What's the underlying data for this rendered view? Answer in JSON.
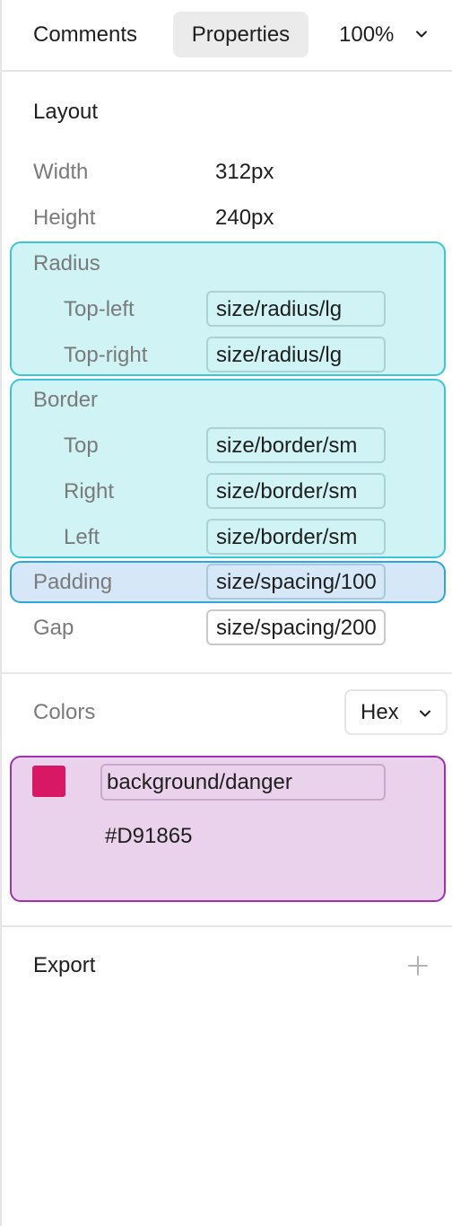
{
  "header": {
    "tabs": [
      {
        "label": "Comments",
        "active": false
      },
      {
        "label": "Properties",
        "active": true
      }
    ],
    "zoom": "100%"
  },
  "layout": {
    "title": "Layout",
    "width_label": "Width",
    "width_value": "312px",
    "height_label": "Height",
    "height_value": "240px",
    "radius": {
      "label": "Radius",
      "top_left_label": "Top-left",
      "top_left_token": "size/radius/lg",
      "top_right_label": "Top-right",
      "top_right_token": "size/radius/lg"
    },
    "border": {
      "label": "Border",
      "top_label": "Top",
      "top_token": "size/border/sm",
      "right_label": "Right",
      "right_token": "size/border/sm",
      "left_label": "Left",
      "left_token": "size/border/sm"
    },
    "padding_label": "Padding",
    "padding_token": "size/spacing/100",
    "gap_label": "Gap",
    "gap_token": "size/spacing/200"
  },
  "colors": {
    "title": "Colors",
    "format": "Hex",
    "token": "background/danger",
    "hex": "#D91865",
    "swatch_color": "#D91865"
  },
  "export": {
    "title": "Export",
    "add_icon": "plus-icon"
  }
}
